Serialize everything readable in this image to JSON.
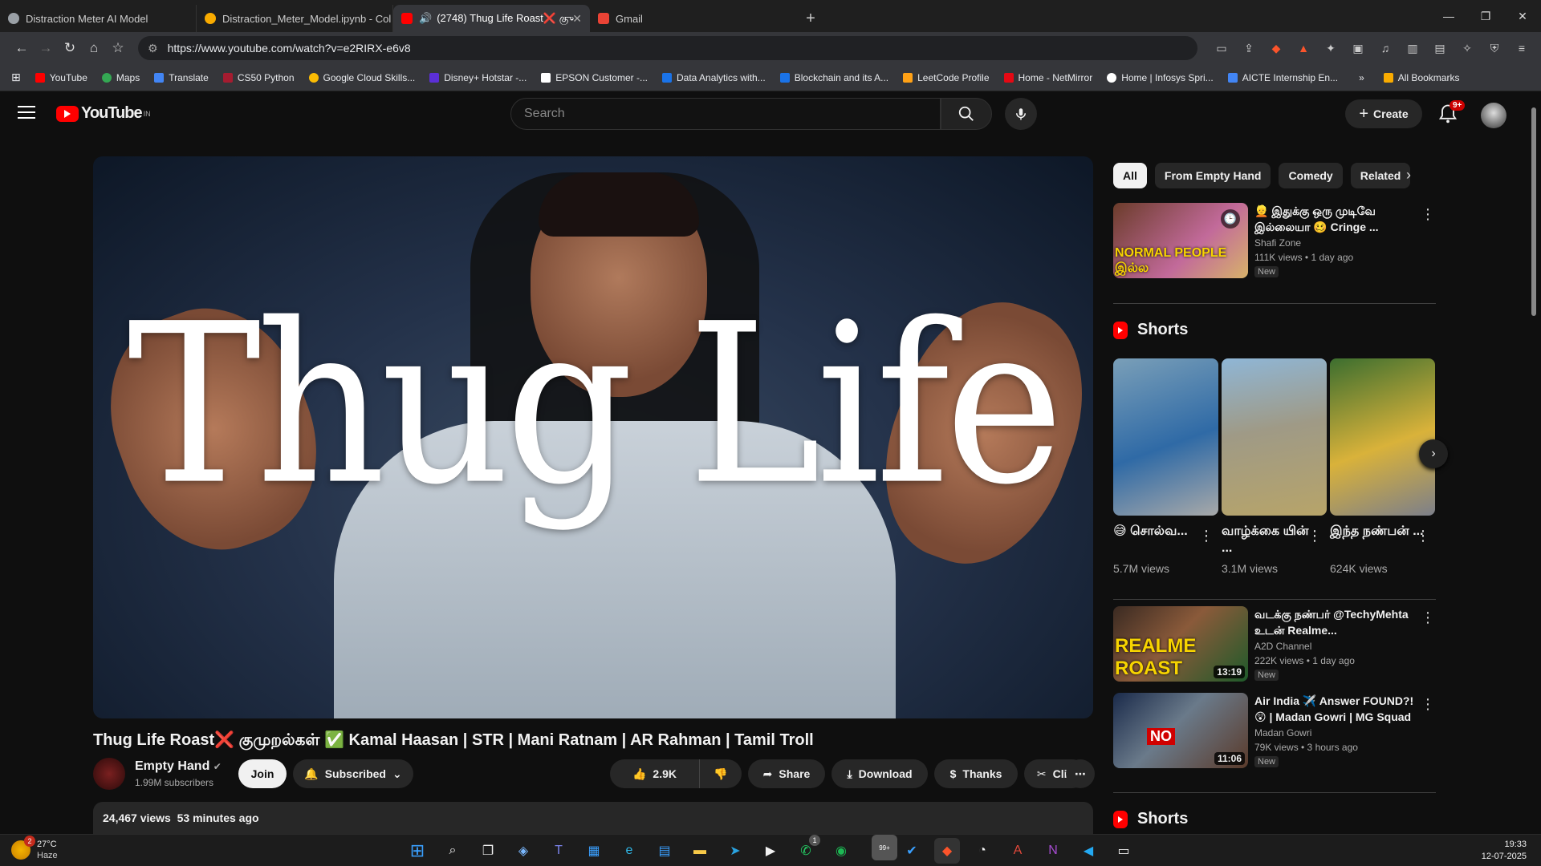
{
  "browser": {
    "tabs": [
      {
        "label": "Distraction Meter AI Model",
        "color": "#9aa0a6"
      },
      {
        "label": "Distraction_Meter_Model.ipynb - Col",
        "color": "#f9ab00"
      },
      {
        "label": "(2748) Thug Life Roast❌ குு",
        "color": "#ff0000"
      },
      {
        "label": "Gmail",
        "color": "#ea4335"
      }
    ],
    "url": "https://www.youtube.com/watch?v=e2RIRX-e6v8",
    "bookmarks": [
      {
        "label": "YouTube",
        "color": "#ff0000"
      },
      {
        "label": "Maps",
        "color": "#34a853"
      },
      {
        "label": "Translate",
        "color": "#4285f4"
      },
      {
        "label": "CS50 Python",
        "color": "#a51c30"
      },
      {
        "label": "Google Cloud Skills...",
        "color": "#fbbc04"
      },
      {
        "label": "Disney+ Hotstar -...",
        "color": "#5b2fd6"
      },
      {
        "label": "EPSON Customer -...",
        "color": "#ffffff"
      },
      {
        "label": "Data Analytics with...",
        "color": "#1a73e8"
      },
      {
        "label": "Blockchain and its A...",
        "color": "#1a73e8"
      },
      {
        "label": "LeetCode Profile",
        "color": "#ffa116"
      },
      {
        "label": "Home - NetMirror",
        "color": "#e50914"
      },
      {
        "label": "Home | Infosys Spri...",
        "color": "#ffffff"
      },
      {
        "label": "AICTE Internship En...",
        "color": "#4285f4"
      }
    ],
    "all_bookmarks": "All Bookmarks"
  },
  "youtube": {
    "logo_text": "YouTube",
    "country": "IN",
    "search_placeholder": "Search",
    "create_label": "Create",
    "notif_count": "9+"
  },
  "video": {
    "overlay_text": "Thug Life",
    "title": "Thug Life Roast❌ குமுறல்கள் ✅ Kamal Haasan | STR | Mani Ratnam | AR Rahman | Tamil Troll",
    "channel": "Empty Hand",
    "subscribers": "1.99M subscribers",
    "join": "Join",
    "subscribed": "Subscribed",
    "likes": "2.9K",
    "share": "Share",
    "download": "Download",
    "thanks": "Thanks",
    "clip": "Clip",
    "views": "24,467 views",
    "age": "53 minutes ago"
  },
  "sidebar": {
    "chips": [
      "All",
      "From Empty Hand",
      "Comedy",
      "Related"
    ],
    "recs": [
      {
        "title": "👱 இதுக்கு ஒரு முடிவே இல்லையா 🥴 Cringe ...",
        "channel": "Shafi Zone",
        "meta": "111K views • 1 day ago",
        "badge": "New",
        "thumb_text": "NORMAL PEOPLE இல்ல"
      },
      {
        "title": "வடக்கு நண்பர் @TechyMehta உடன் Realme...",
        "channel": "A2D Channel",
        "meta": "222K views • 1 day ago",
        "badge": "New",
        "thumb_text": "REALME ROAST",
        "duration": "13:19"
      },
      {
        "title": "Air India ✈️ Answer FOUND?! 😲 | Madan Gowri | MG Squad ...",
        "channel": "Madan Gowri",
        "meta": "79K views • 3 hours ago",
        "badge": "New",
        "thumb_text": "NO",
        "duration": "11:06"
      }
    ],
    "shorts_label": "Shorts",
    "shorts": [
      {
        "title": "😅 சொல்வ...",
        "views": "5.7M views"
      },
      {
        "title": "வாழ்க்கை யின் ...",
        "views": "3.1M views"
      },
      {
        "title": "இந்த நண்பன் ...",
        "views": "624K views"
      }
    ],
    "shorts_label_2": "Shorts"
  },
  "taskbar": {
    "temp": "27°C",
    "weather": "Haze",
    "weather_badge": "2",
    "time": "19:33",
    "date": "12-07-2025",
    "whatsapp_badge": "1",
    "mail_badge": "99+"
  }
}
